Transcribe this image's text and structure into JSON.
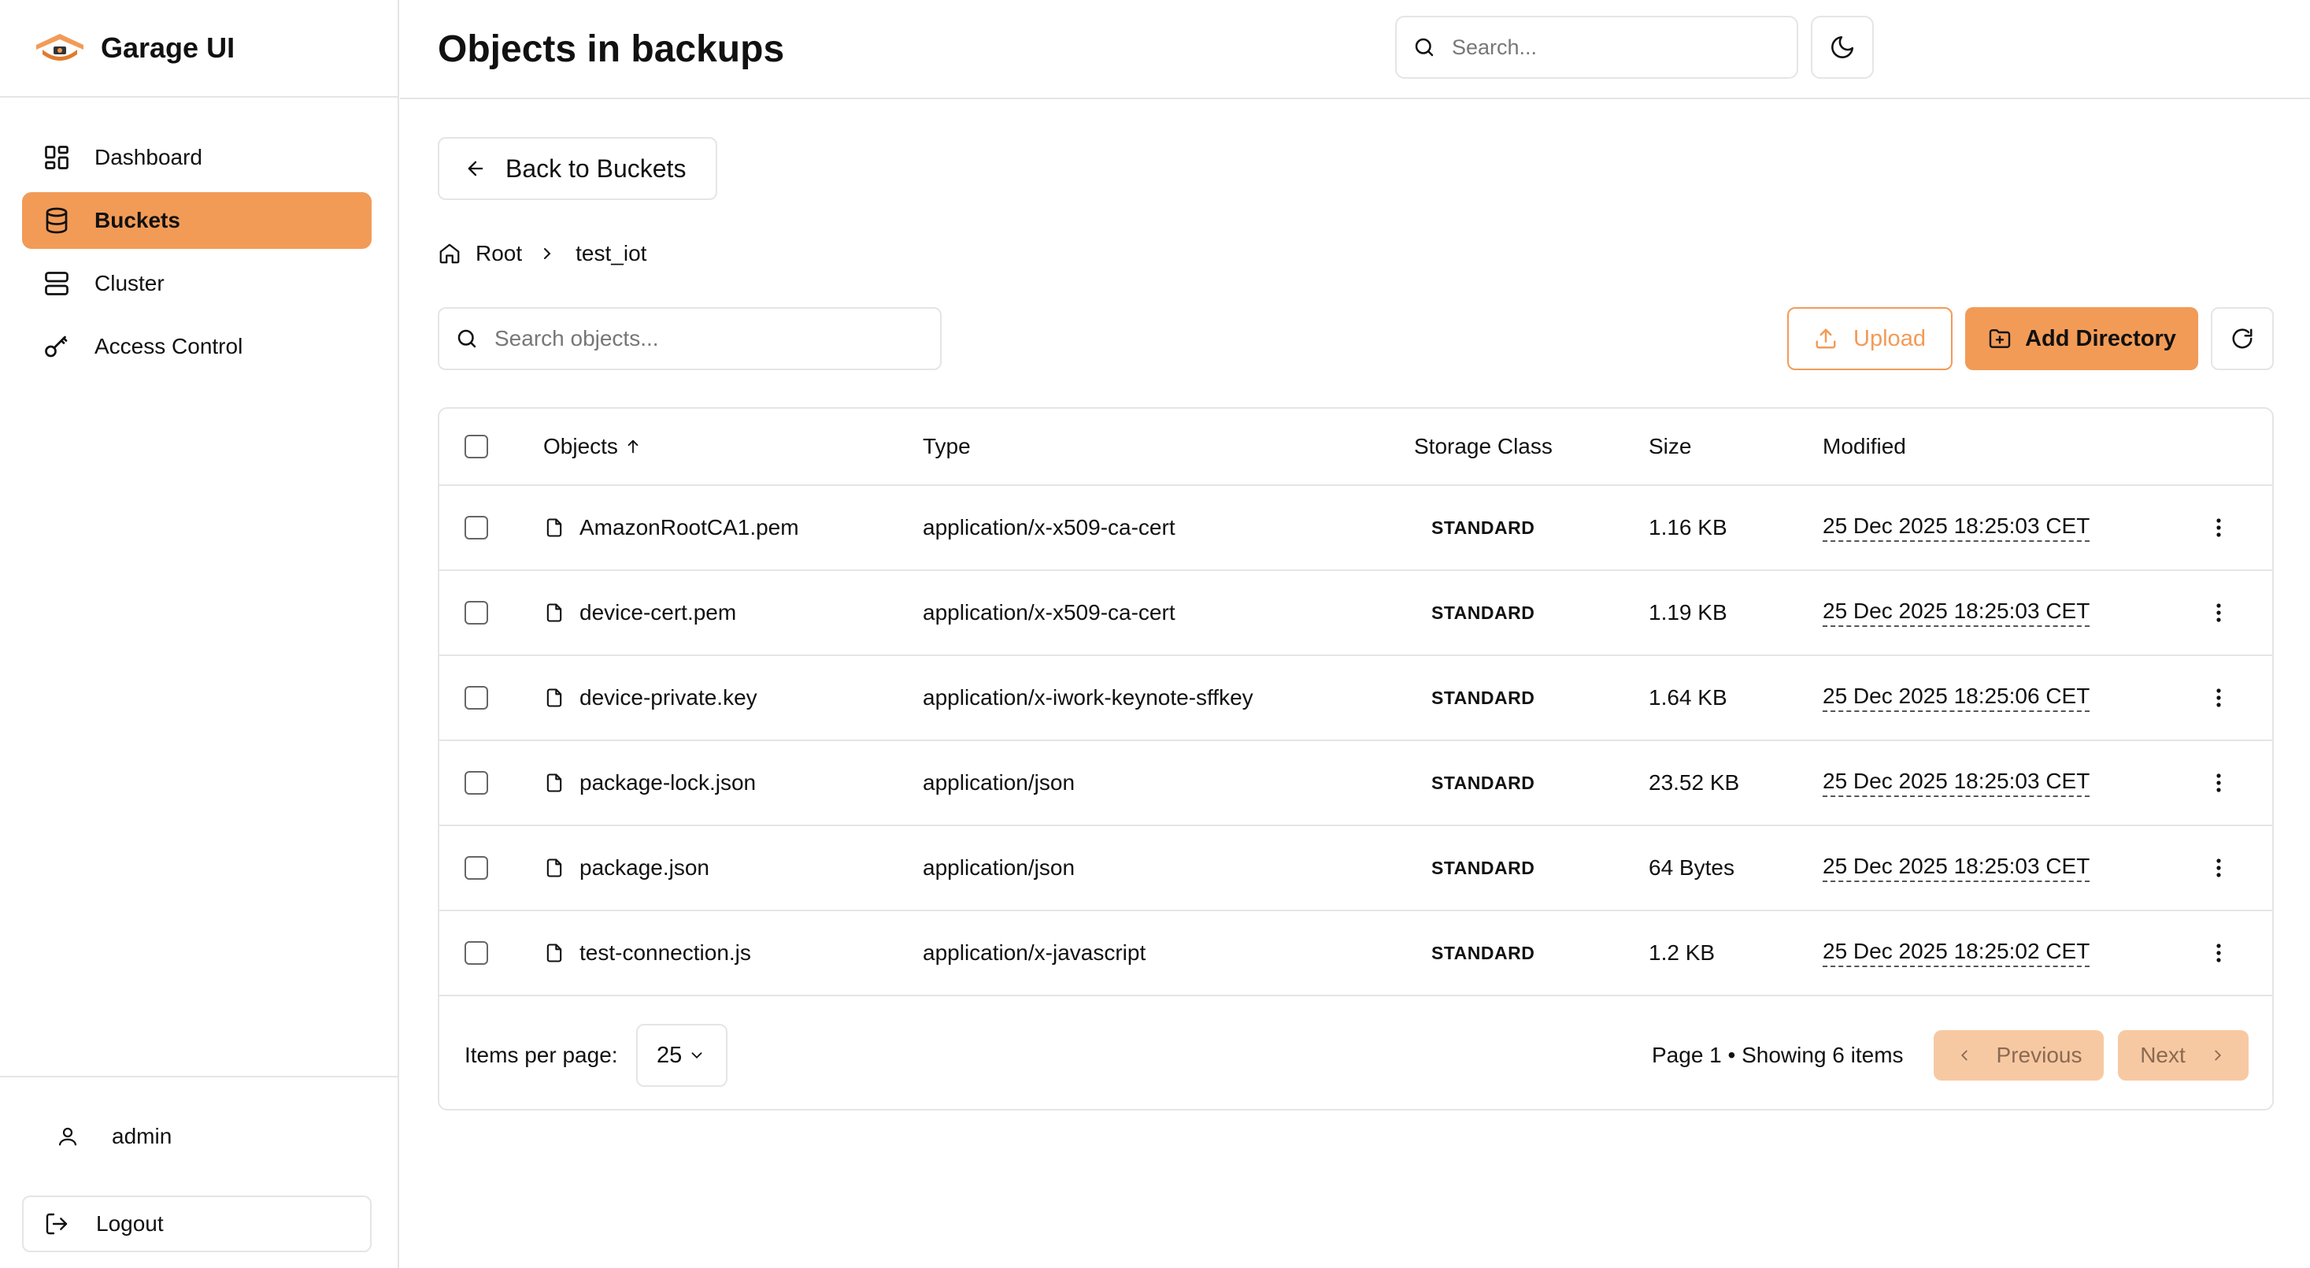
{
  "app": {
    "name": "Garage UI",
    "accent_color": "#f29b57"
  },
  "sidebar": {
    "items": [
      {
        "label": "Dashboard",
        "icon": "dashboard-icon",
        "active": false
      },
      {
        "label": "Buckets",
        "icon": "database-icon",
        "active": true
      },
      {
        "label": "Cluster",
        "icon": "server-icon",
        "active": false
      },
      {
        "label": "Access Control",
        "icon": "key-icon",
        "active": false
      }
    ],
    "user": {
      "name": "admin",
      "icon": "user-icon"
    },
    "logout_label": "Logout"
  },
  "header": {
    "title": "Objects in backups",
    "search_placeholder": "Search...",
    "theme_icon": "moon-icon"
  },
  "main": {
    "back_label": "Back to Buckets",
    "breadcrumb": {
      "root": "Root",
      "current": "test_iot"
    },
    "search_placeholder": "Search objects...",
    "upload_label": "Upload",
    "add_directory_label": "Add Directory"
  },
  "table": {
    "columns": {
      "objects": "Objects",
      "type": "Type",
      "storage_class": "Storage Class",
      "size": "Size",
      "modified": "Modified"
    },
    "sort": {
      "column": "objects",
      "direction": "ascending"
    },
    "rows": [
      {
        "name": "AmazonRootCA1.pem",
        "type": "application/x-x509-ca-cert",
        "storage_class": "STANDARD",
        "size": "1.16 KB",
        "modified": "25 Dec 2025 18:25:03 CET"
      },
      {
        "name": "device-cert.pem",
        "type": "application/x-x509-ca-cert",
        "storage_class": "STANDARD",
        "size": "1.19 KB",
        "modified": "25 Dec 2025 18:25:03 CET"
      },
      {
        "name": "device-private.key",
        "type": "application/x-iwork-keynote-sffkey",
        "storage_class": "STANDARD",
        "size": "1.64 KB",
        "modified": "25 Dec 2025 18:25:06 CET"
      },
      {
        "name": "package-lock.json",
        "type": "application/json",
        "storage_class": "STANDARD",
        "size": "23.52 KB",
        "modified": "25 Dec 2025 18:25:03 CET"
      },
      {
        "name": "package.json",
        "type": "application/json",
        "storage_class": "STANDARD",
        "size": "64 Bytes",
        "modified": "25 Dec 2025 18:25:03 CET"
      },
      {
        "name": "test-connection.js",
        "type": "application/x-javascript",
        "storage_class": "STANDARD",
        "size": "1.2 KB",
        "modified": "25 Dec 2025 18:25:02 CET"
      }
    ]
  },
  "pagination": {
    "items_per_page_label": "Items per page:",
    "items_per_page": "25",
    "page_info": "Page 1 • Showing 6 items",
    "previous_label": "Previous",
    "next_label": "Next"
  }
}
